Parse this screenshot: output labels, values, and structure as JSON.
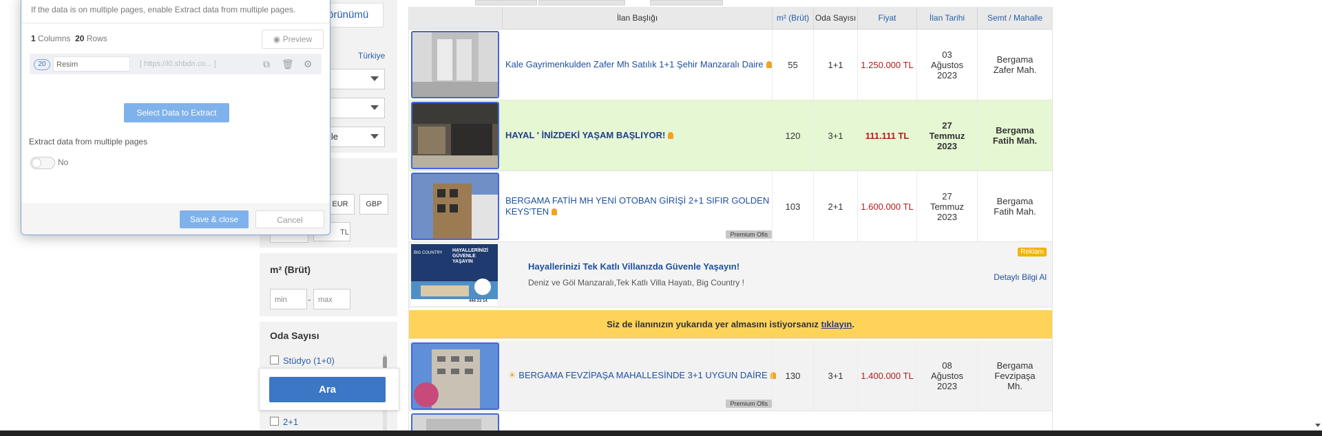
{
  "dialog": {
    "hint": "If the data is on multiple pages, enable Extract data from multiple pages.",
    "columns_count": "1",
    "columns_label": "Columns",
    "rows_count": "20",
    "rows_label": "Rows",
    "preview_label": "Preview",
    "column": {
      "badge": "20",
      "name": "Resim",
      "url": "https://i0.shbdn.co..."
    },
    "select_data_label": "Select Data to Extract",
    "multi_pages_label": "Extract data from multiple pages",
    "toggle_label": "No",
    "save_label": "Save & close",
    "cancel_label": "Cancel"
  },
  "filters": {
    "tab_label": "örünümü",
    "country_link": "Türkiye",
    "select3_text": "lle",
    "currencies": [
      "EUR",
      "GBP"
    ],
    "tl_label": "TL",
    "area_title": "m² (Brüt)",
    "min_placeholder": "min",
    "max_placeholder": "max",
    "range_dash": "-",
    "rooms_title": "Oda Sayısı",
    "rooms": [
      "Stüdyo (1+0)",
      "2+1"
    ],
    "search_button": "Ara"
  },
  "table": {
    "headers": [
      "İlan Başlığı",
      "m² (Brüt)",
      "Oda Sayısı",
      "Fiyat",
      "İlan Tarihi",
      "Semt / Mahalle"
    ],
    "rows": [
      {
        "title": "Kale Gayrimenkulden Zafer Mh Satılık 1+1 Şehir Manzaralı Daire",
        "m2": "55",
        "rooms": "1+1",
        "price": "1.250.000 TL",
        "date": "03 Ağustos 2023",
        "location": "Bergama Zafer Mah.",
        "premium": ""
      },
      {
        "title": "HAYAL ' İNİZDEKİ YAŞAM BAŞLIYOR!",
        "m2": "120",
        "rooms": "3+1",
        "price": "111.111 TL",
        "date": "27 Temmuz 2023",
        "location": "Bergama Fatih Mah.",
        "premium": ""
      },
      {
        "title": "BERGAMA FATİH MH YENİ OTOBAN GİRİŞİ 2+1 SIFIR GOLDEN KEYS'TEN",
        "m2": "103",
        "rooms": "2+1",
        "price": "1.600.000 TL",
        "date": "27 Temmuz 2023",
        "location": "Bergama Fatih Mah.",
        "premium": "Premium Ofis"
      },
      {
        "title": "BERGAMA FEVZİPAŞA MAHALLESİNDE 3+1 UYGUN DAİRE",
        "m2": "130",
        "rooms": "3+1",
        "price": "1.400.000 TL",
        "date": "08 Ağustos 2023",
        "location": "Bergama Fevzipaşa Mh.",
        "premium": "Premium Ofis"
      }
    ],
    "ad": {
      "badge": "Reklam",
      "title": "Hayallerinizi Tek Katlı Villanızda Güvenle Yaşayın!",
      "desc": "Deniz ve Göl Manzaralı,Tek Katlı Villa Hayatı, Big Country !",
      "cta": "Detaylı Bilgi Al",
      "img_brand": "BIG COUNTRY",
      "img_headline": "HAYALLERİNİZİ GÜVENLE YAŞAYIN",
      "img_phone": "444 23 14"
    },
    "banner": {
      "text": "Siz de ilanınızın yukarıda yer almasını istiyorsanız",
      "link": "tıklayın",
      "end": "."
    }
  },
  "colors": {
    "accent": "#3b77c4",
    "price": "#b01c1c",
    "highlight_row": "#e6f7d3",
    "banner": "#fdd35a",
    "badge": "#f0b400"
  }
}
